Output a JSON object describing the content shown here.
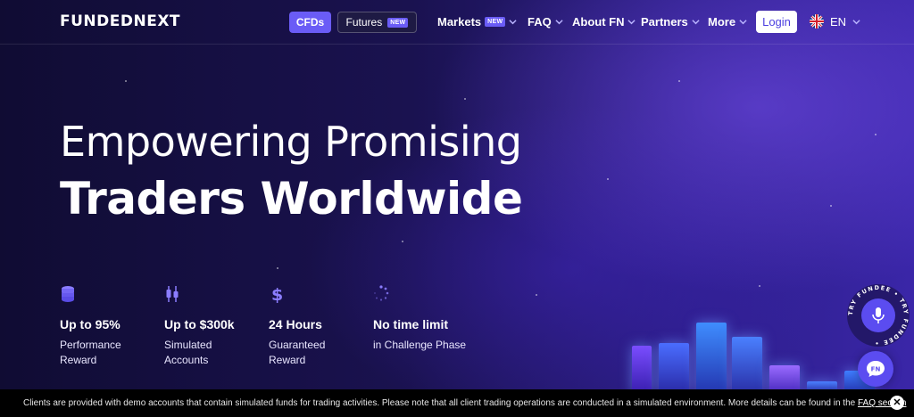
{
  "brand": {
    "logo_text": "FUNDEDNEXT"
  },
  "nav": {
    "cfds_label": "CFDs",
    "futures_label": "Futures",
    "futures_badge": "NEW",
    "markets_label": "Markets",
    "markets_badge": "NEW",
    "faq_label": "FAQ",
    "about_label": "About FN",
    "partners_label": "Partners",
    "more_label": "More",
    "login_label": "Login",
    "language_label": "EN",
    "language_flag": "uk-flag-icon"
  },
  "hero": {
    "line1": "Empowering Promising",
    "line2": "Traders Worldwide"
  },
  "stats": [
    {
      "icon": "coins-stack-icon",
      "value": "Up to 95%",
      "desc_line1": "Performance",
      "desc_line2": "Reward"
    },
    {
      "icon": "candlestick-icon",
      "value": "Up to $300k",
      "desc_line1": "Simulated",
      "desc_line2": "Accounts"
    },
    {
      "icon": "dollar-icon",
      "value": "24 Hours",
      "desc_line1": "Guaranteed",
      "desc_line2": "Reward"
    },
    {
      "icon": "loading-clock-icon",
      "value": "No time limit",
      "desc_line1": "in Challenge Phase",
      "desc_line2": ""
    }
  ],
  "widgets": {
    "try_badge_text": "TRY FUNDEE • TRY FUNDEE •",
    "voice_icon": "microphone-icon",
    "chat_label": "FN"
  },
  "notice": {
    "text": "Clients are provided with demo accounts that contain simulated funds for trading activities. Please note that all client trading operations are conducted in a simulated environment. More details can be found in the ",
    "link_text": "FAQ section",
    "close_icon": "close-icon"
  },
  "colors": {
    "accent": "#6a5cf6",
    "background_dark": "#100c33",
    "background_light": "#3a26a8",
    "notice_bg": "#000000"
  }
}
